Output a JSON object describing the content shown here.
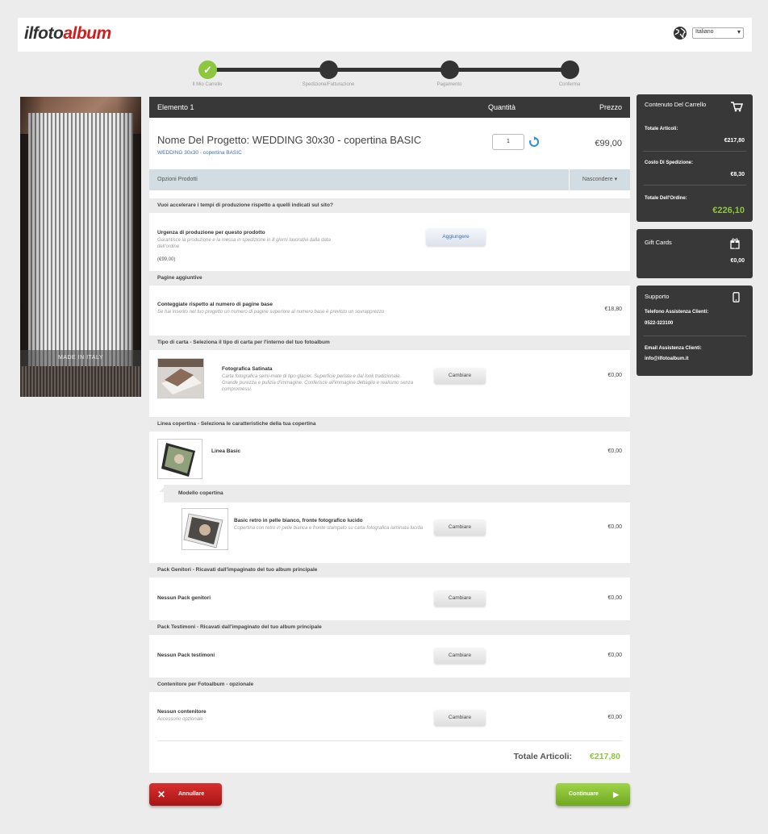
{
  "header": {
    "logo_part1": "ilfoto",
    "logo_part2": "album",
    "language": "Italiano"
  },
  "steps": [
    {
      "label": "Il Mio Carrello",
      "done": true
    },
    {
      "label": "Spedizione/Fatturazione",
      "done": false
    },
    {
      "label": "Pagamento",
      "done": false
    },
    {
      "label": "Conferma",
      "done": false
    }
  ],
  "photo": {
    "caption": "MADE IN ITALY"
  },
  "table_head": {
    "item": "Elemento 1",
    "qty": "Quantità",
    "price": "Prezzo"
  },
  "product": {
    "title": "Nome Del Progetto: WEDDING 30x30 - copertina BASIC",
    "subtitle": "WEDDING 30x30 - copertina BASIC",
    "quantity": "1",
    "price": "€99,00"
  },
  "options_bar": {
    "label": "Opzioni Prodotti",
    "toggle": "Nascondere ▾"
  },
  "sections": {
    "urgency_q": "Vuoi accelerare i tempi di produzione rispetto a quelli indicati sul sito?",
    "extra_pages": "Pagine aggiuntive",
    "paper": "Tipo di carta - Seleziona il tipo di carta per l'interno del tuo fotoalbum",
    "cover_line": "Linea copertina - Seleziona le caratteristiche della tua copertina",
    "cover_model": "Modello copertina",
    "parents_pack": "Pack Genitori - Ricavati dall'impaginato del tuo album principale",
    "witness_pack": "Pack Testimoni - Ricavati dall'impaginato del tuo album principale",
    "container": "Contenitore per Fotoalbum - opzionale"
  },
  "rows": {
    "urgency": {
      "title": "Urgenza di produzione per questo prodotto",
      "desc": "Garantisce la produzione e la messa in spedizione in 8 giorni lavorativi dalla data dell'ordine",
      "price": "(€99,00)",
      "button": "Aggiungere"
    },
    "pages": {
      "title": "Conteggiate rispetto al numero di pagine base",
      "desc": "Se hai inserito nel tuo progetto un numero di pagine superiore al numero base è previsto un sovrapprezzo",
      "price": "€18,80"
    },
    "paper": {
      "title": "Fotografica Satinata",
      "desc": "Carta fotografica semi-mate di tipo glacier. Superficie perlata e dal look tradizionale. Grande purezza e pulizia d'immagine. Conferisce all'immagine dettaglio e realismo senza compromessi.",
      "button": "Cambiare",
      "price": "€0,00"
    },
    "cover_line": {
      "title": "Linea Basic",
      "price": "€0,00"
    },
    "cover_model": {
      "title": "Basic retro in pelle bianco, fronte fotografico lucido",
      "desc": "Copertina con retro in pelle bianca e fronte stampato su carta fotografica laminata lucida",
      "button": "Cambiare",
      "price": "€0,00"
    },
    "parents": {
      "title": "Nessun Pack genitori",
      "button": "Cambiare",
      "price": "€0,00"
    },
    "witness": {
      "title": "Nessun Pack testimoni",
      "button": "Cambiare",
      "price": "€0,00"
    },
    "container": {
      "title": "Nessun contenitore",
      "desc": "Accessorio opzionale",
      "button": "Cambiare",
      "price": "€0,00"
    }
  },
  "totals": {
    "label": "Totale Articoli:",
    "value": "€217,80"
  },
  "cart_box": {
    "title": "Contenuto Del Carrello",
    "items_label": "Totale Articoli:",
    "items_value": "€217,80",
    "shipping_label": "Costo Di Spedizione:",
    "shipping_value": "€8,30",
    "order_label": "Totale Dell'Ordine:",
    "order_value": "€226,10"
  },
  "gift_box": {
    "title": "Gift Cards",
    "value": "€0,00"
  },
  "support_box": {
    "title": "Supporto",
    "phone_label": "Telefono Assistenza Clienti:",
    "phone_value": "0522-323100",
    "email_label": "Email Assistenza Clienti:",
    "email_value": "info@ilfotoalbum.it"
  },
  "buttons": {
    "cancel": "Annullare",
    "continue": "Continuare"
  },
  "colors": {
    "green": "#8dc63f",
    "red": "#c62020",
    "dark": "#383838",
    "blue": "#3a6fb0"
  }
}
